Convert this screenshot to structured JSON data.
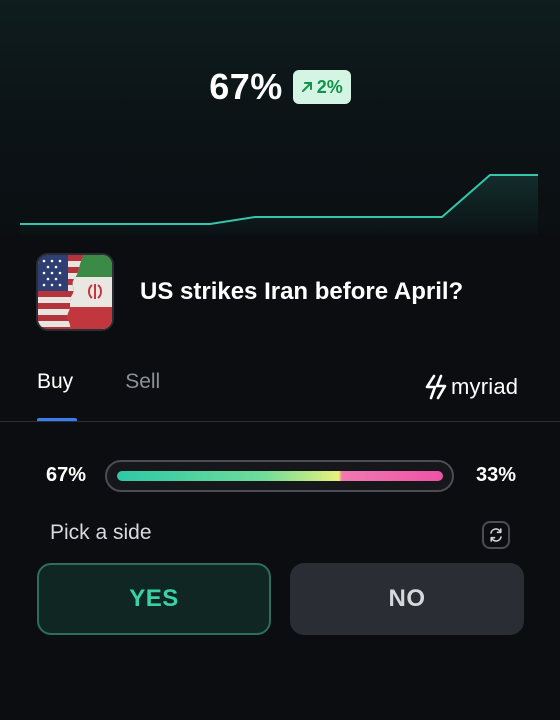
{
  "header": {
    "odds_percent": "67%",
    "change_text": "2%",
    "change_icon": "arrow-up-right-icon",
    "change_color": "#12924a"
  },
  "market": {
    "thumbnail_icon": "us-iran-flags-image",
    "title": "US strikes Iran before April?"
  },
  "tabs": [
    {
      "label": "Buy",
      "active": true
    },
    {
      "label": "Sell",
      "active": false
    }
  ],
  "brand": {
    "name": "myriad",
    "icon": "myriad-logo-icon"
  },
  "probability": {
    "yes_pct_label": "67%",
    "no_pct_label": "33%",
    "yes_fraction": 0.67
  },
  "pick": {
    "label": "Pick a side",
    "refresh_icon": "refresh-icon"
  },
  "buttons": {
    "yes_label": "YES",
    "no_label": "NO"
  },
  "colors": {
    "accent": "#3b7cf2",
    "yes": "#3bd1a6",
    "line": "#36c4ab"
  }
}
